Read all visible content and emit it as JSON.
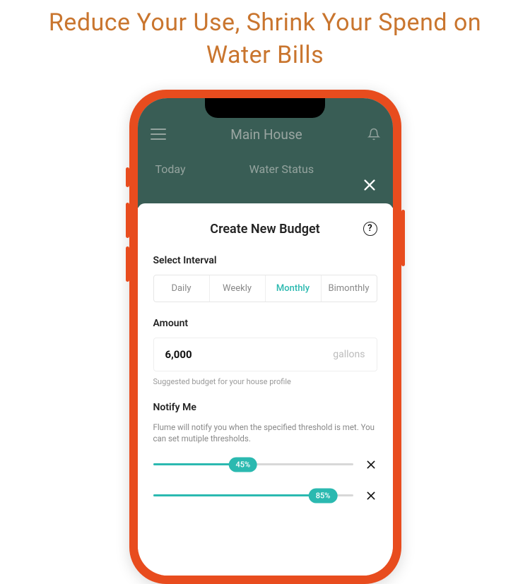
{
  "hero": {
    "title": "Reduce Your Use, Shrink Your Spend on Water Bills"
  },
  "app": {
    "header_title": "Main House",
    "tabs": {
      "today": "Today",
      "water_status": "Water Status"
    }
  },
  "sheet": {
    "title": "Create New Budget",
    "help_glyph": "?",
    "interval_label": "Select Interval",
    "intervals": {
      "daily": "Daily",
      "weekly": "Weekly",
      "monthly": "Monthly",
      "bimonthly": "Bimonthly"
    },
    "amount_label": "Amount",
    "amount_value": "6,000",
    "amount_unit": "gallons",
    "amount_hint": "Suggested budget for your house profile",
    "notify_label": "Notify Me",
    "notify_desc": "Flume will notify you when the specified threshold is met. You can set mutiple thresholds.",
    "thresholds": [
      {
        "percent": 45,
        "label": "45%"
      },
      {
        "percent": 85,
        "label": "85%"
      }
    ]
  }
}
